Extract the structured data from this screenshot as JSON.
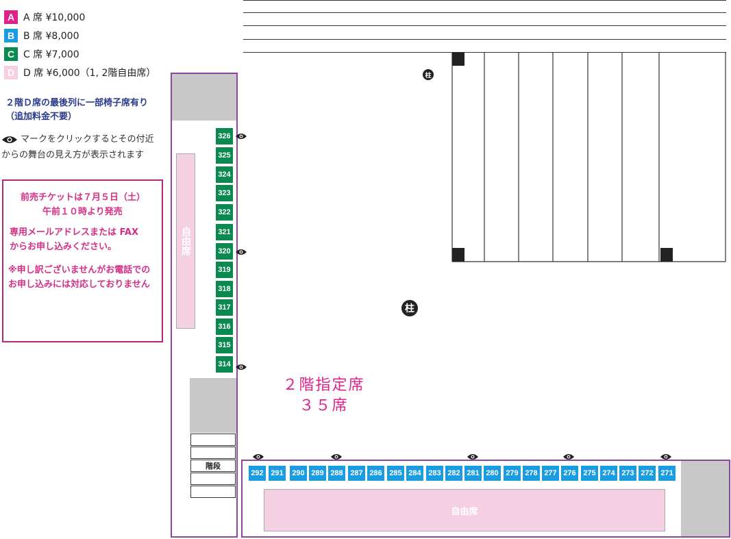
{
  "legend": [
    {
      "letter": "A",
      "text": "A 席 ¥10,000",
      "color": "#e0218a",
      "letter_color": "#ffffff"
    },
    {
      "letter": "B",
      "text": "B 席 ¥8,000",
      "color": "#1a9ce0",
      "letter_color": "#ffffff"
    },
    {
      "letter": "C",
      "text": "C 席 ¥7,000",
      "color": "#0b8a4f",
      "letter_color": "#ffffff"
    },
    {
      "letter": "D",
      "text": "D 席 ¥6,000（1, 2階自由席）",
      "color": "#f5cfe2",
      "letter_color": "#ffffff"
    }
  ],
  "notes": {
    "chair_line1": "２階Ｄ席の最後列に一部椅子席有り",
    "chair_line2": "（追加料金不要）",
    "eye_line1": "マークをクリックするとその付近",
    "eye_line2": "からの舞台の見え方が表示されます"
  },
  "notice": {
    "line1": "前売チケットは７月５日（土）",
    "line2": "午前１０時より発売",
    "line3": "専用メールアドレスまたは FAX",
    "line4": "からお申し込みください。",
    "line5": "※申し訳ございませんがお電話での",
    "line6": "お申し込みには対応しておりません"
  },
  "map": {
    "pillar_label": "柱",
    "free_seat_label": "自由席",
    "stairs_label": "階段",
    "reserved_title": "２階指定席",
    "reserved_count": "３５席"
  },
  "seats_c": [
    "326",
    "325",
    "324",
    "323",
    "322",
    "321",
    "320",
    "319",
    "318",
    "317",
    "316",
    "315",
    "314"
  ],
  "seats_b": [
    "292",
    "291",
    "290",
    "289",
    "288",
    "287",
    "286",
    "285",
    "284",
    "283",
    "282",
    "281",
    "280",
    "279",
    "278",
    "277",
    "276",
    "275",
    "274",
    "273",
    "272",
    "271"
  ],
  "colors": {
    "magenta": "#e0218a",
    "purple_border": "#8e44a0",
    "green_seat": "#0b8a4f",
    "blue_seat": "#1a9ce0",
    "pink_free": "#f5cfe2"
  }
}
